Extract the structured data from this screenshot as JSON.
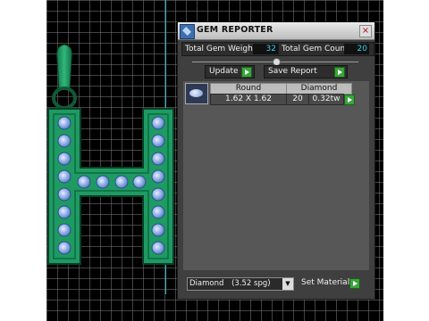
{
  "panel": {
    "title": "GEM REPORTER",
    "total_weight_label": "Total Gem Weight",
    "total_weight_value": "32",
    "total_count_label": "Total Gem Count",
    "total_count_value": "20",
    "update_label": "Update",
    "save_report_label": "Save Report",
    "table": {
      "headers": [
        "Round",
        "Diamond"
      ],
      "row": {
        "size": "1.62 X 1.62",
        "count": "20",
        "weight": "0.32tw"
      }
    },
    "material_select": {
      "value": "Diamond",
      "detail": "(3.52 spg)"
    },
    "set_material_label": "Set Material"
  },
  "icons": [
    "app-icon",
    "close-icon",
    "dropdown-arrow-icon",
    "play-icon",
    "round-gem-icon"
  ],
  "colors": {
    "panel_bg": "#3f3f3f",
    "value_text": "#35d7e8",
    "gem_metal": "#1f9a63",
    "gem_stone": "#7fa2df"
  }
}
